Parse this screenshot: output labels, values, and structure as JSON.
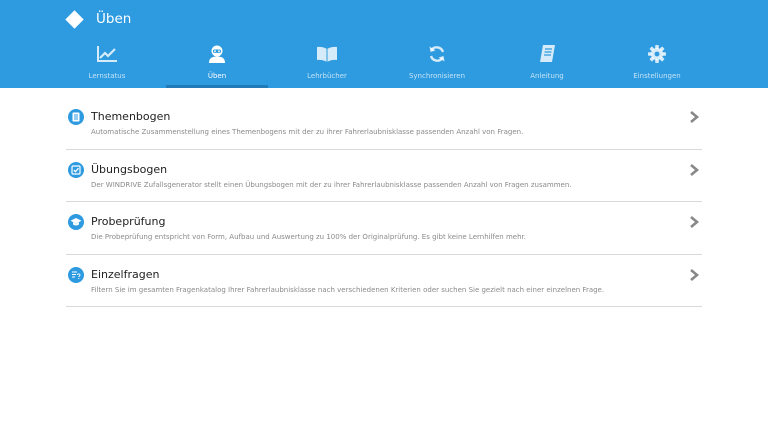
{
  "header": {
    "title": "Üben",
    "background_color": "#2e9be0",
    "active_indicator_color": "#217bb7",
    "logo_icon": "diamond-logo-icon"
  },
  "tabs": [
    {
      "label": "Lernstatus",
      "icon": "chart-line-icon",
      "active": false
    },
    {
      "label": "Üben",
      "icon": "learner-user-icon",
      "active": true
    },
    {
      "label": "Lehrbücher",
      "icon": "open-book-icon",
      "active": false
    },
    {
      "label": "Synchronisieren",
      "icon": "sync-icon",
      "active": false
    },
    {
      "label": "Anleitung",
      "icon": "manual-book-icon",
      "active": false
    },
    {
      "label": "Einstellungen",
      "icon": "gear-icon",
      "active": false
    }
  ],
  "items": [
    {
      "title": "Themenbogen",
      "description": "Automatische Zusammenstellung eines Themenbogens mit der zu ihrer Fahrerlaubnisklasse passenden Anzahl von Fragen.",
      "icon": "document-list-icon"
    },
    {
      "title": "Übungsbogen",
      "description": "Der WINDRIVE Zufallsgenerator stellt einen Übungsbogen mit der zu ihrer Fahrerlaubnisklasse passenden Anzahl von Fragen zusammen.",
      "icon": "checkbox-icon"
    },
    {
      "title": "Probeprüfung",
      "description": "Die Probeprüfung entspricht von Form, Aufbau und Auswertung zu 100% der Originalprüfung. Es gibt keine Lernhilfen mehr.",
      "icon": "graduation-cap-icon"
    },
    {
      "title": "Einzelfragen",
      "description": "Filtern Sie im gesamten Fragenkatalog Ihrer Fahrerlaubnisklasse nach verschiedenen Kriterien oder suchen Sie gezielt nach einer einzelnen Frage.",
      "icon": "question-list-icon"
    }
  ]
}
